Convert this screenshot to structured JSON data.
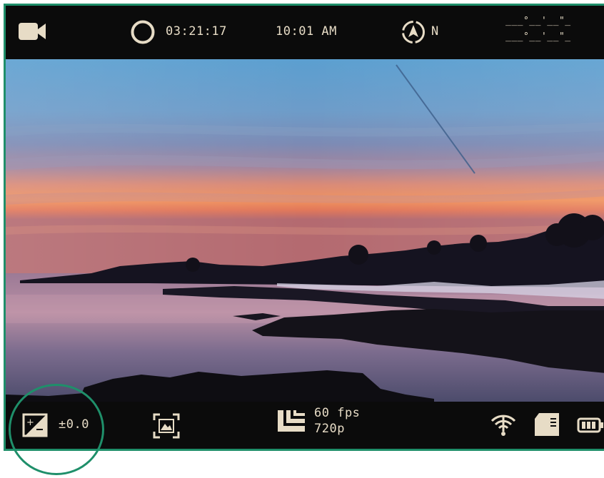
{
  "status_bar": {
    "record_time": "03:21:17",
    "clock": "10:01 AM",
    "compass_heading": "N",
    "coordinates_line1": "___°__'__\"_",
    "coordinates_line2": "___°__'__\"_"
  },
  "bottom_bar": {
    "exposure_value": "±0.0",
    "frame_rate": "60 fps",
    "resolution": "720p"
  },
  "icons": {
    "mode": "video-camera-icon",
    "record": "record-ring-icon",
    "compass": "compass-icon",
    "exposure": "exposure-compensation-icon",
    "scene": "scene-frame-icon",
    "stabilize": "stabilization-icon",
    "wifi": "wifi-icon",
    "storage": "sd-card-icon",
    "battery": "battery-icon"
  },
  "colors": {
    "ui_text": "#e7dcc6",
    "annotation": "#1f8f6a",
    "bar_bg": "#0b0b0b"
  }
}
